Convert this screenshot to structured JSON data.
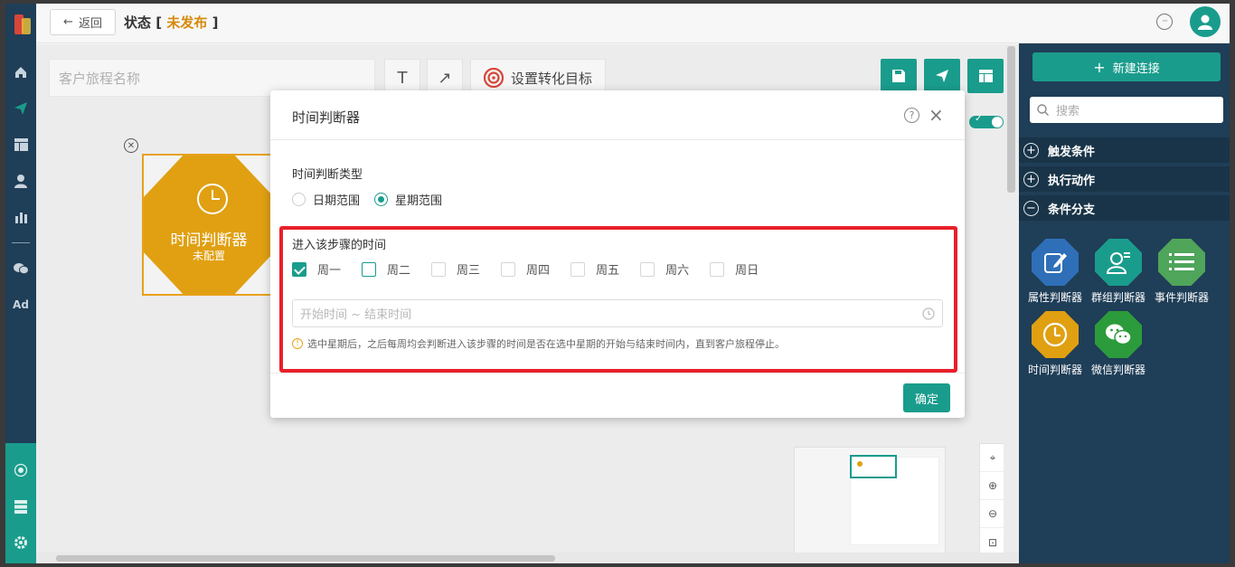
{
  "colors": {
    "accent": "#1a9c8c",
    "nav_bg": "#1f3e57",
    "node": "#e0a012",
    "status": "#d68a0a",
    "highlight": "#e8202a"
  },
  "topbar": {
    "back_label": "返回",
    "title": "状态",
    "bracket_open": "[",
    "status": "未发布",
    "bracket_close": "]"
  },
  "toolbar": {
    "journey_name_placeholder": "客户旅程名称",
    "text_tool": "T",
    "arrow_tool": "↗",
    "goal_label": "设置转化目标"
  },
  "node": {
    "title": "时间判断器",
    "subtitle": "未配置"
  },
  "nav": {
    "ad_label": "Ad"
  },
  "right_panel": {
    "new_connection": "新建连接",
    "search_placeholder": "搜索",
    "sections": [
      {
        "label": "触发条件",
        "symbol": "+"
      },
      {
        "label": "执行动作",
        "symbol": "+"
      },
      {
        "label": "条件分支",
        "symbol": "−"
      }
    ],
    "palette": [
      {
        "label": "属性判断器",
        "icon": "edit-icon",
        "color": "#2e6fb8"
      },
      {
        "label": "群组判断器",
        "icon": "group-icon",
        "color": "#1a9c8c"
      },
      {
        "label": "事件判断器",
        "icon": "list-icon",
        "color": "#4fa55a"
      },
      {
        "label": "时间判断器",
        "icon": "clock-icon",
        "color": "#e0a012"
      },
      {
        "label": "微信判断器",
        "icon": "wechat-icon",
        "color": "#2c9b3b"
      }
    ]
  },
  "modal": {
    "title": "时间判断器",
    "type_label": "时间判断类型",
    "radio_options": [
      {
        "label": "日期范围",
        "selected": false
      },
      {
        "label": "星期范围",
        "selected": true
      }
    ],
    "enter_label": "进入该步骤的时间",
    "weekdays": [
      {
        "label": "周一",
        "checked": true
      },
      {
        "label": "周二",
        "checked": false
      },
      {
        "label": "周三",
        "checked": false
      },
      {
        "label": "周四",
        "checked": false
      },
      {
        "label": "周五",
        "checked": false
      },
      {
        "label": "周六",
        "checked": false
      },
      {
        "label": "周日",
        "checked": false
      }
    ],
    "time_range_placeholder": "开始时间 ~ 结束时间",
    "hint": "选中星期后，之后每周均会判断进入该步骤的时间是否在选中星期的开始与结束时间内，直到客户旅程停止。",
    "confirm_label": "确定"
  }
}
